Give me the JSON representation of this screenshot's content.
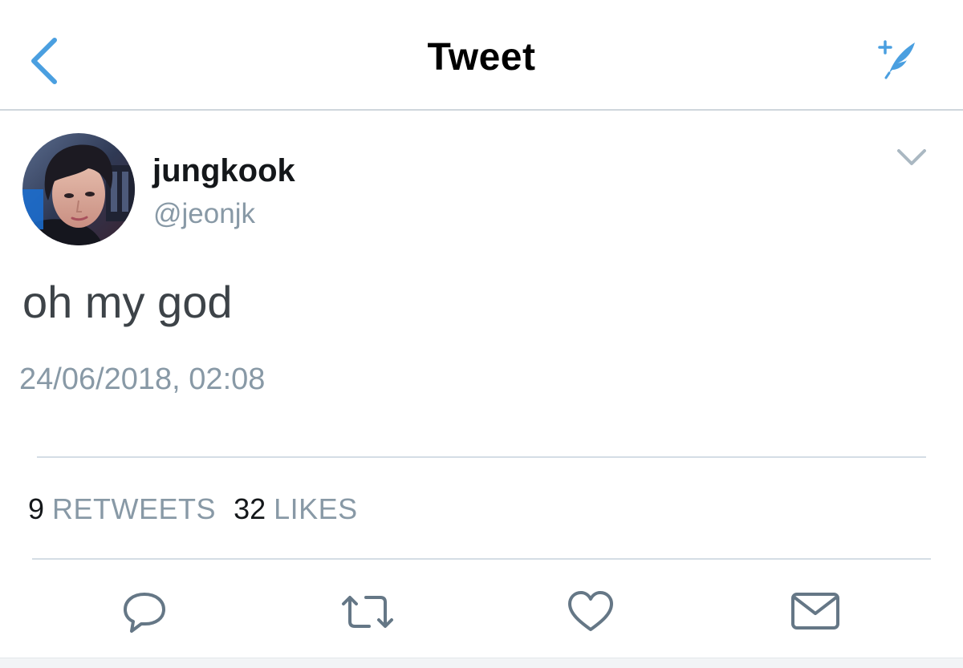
{
  "nav": {
    "title": "Tweet"
  },
  "tweet": {
    "display_name": "jungkook",
    "handle": "@jeonjk",
    "text": "oh my god",
    "timestamp": "24/06/2018, 02:08"
  },
  "stats": {
    "retweets_count": "9",
    "retweets_label": "RETWEETS",
    "likes_count": "32",
    "likes_label": "LIKES"
  },
  "icons": {
    "back": "chevron-left-icon",
    "compose": "feather-sparkle-icon",
    "menu": "chevron-down-icon",
    "reply": "speech-bubble-icon",
    "retweet": "retweet-arrows-icon",
    "like": "heart-icon",
    "share": "envelope-icon"
  },
  "colors": {
    "accent": "#4a9fe0",
    "text_primary": "#14171a",
    "text_secondary": "#8899a6",
    "divider": "#d4dde5"
  }
}
